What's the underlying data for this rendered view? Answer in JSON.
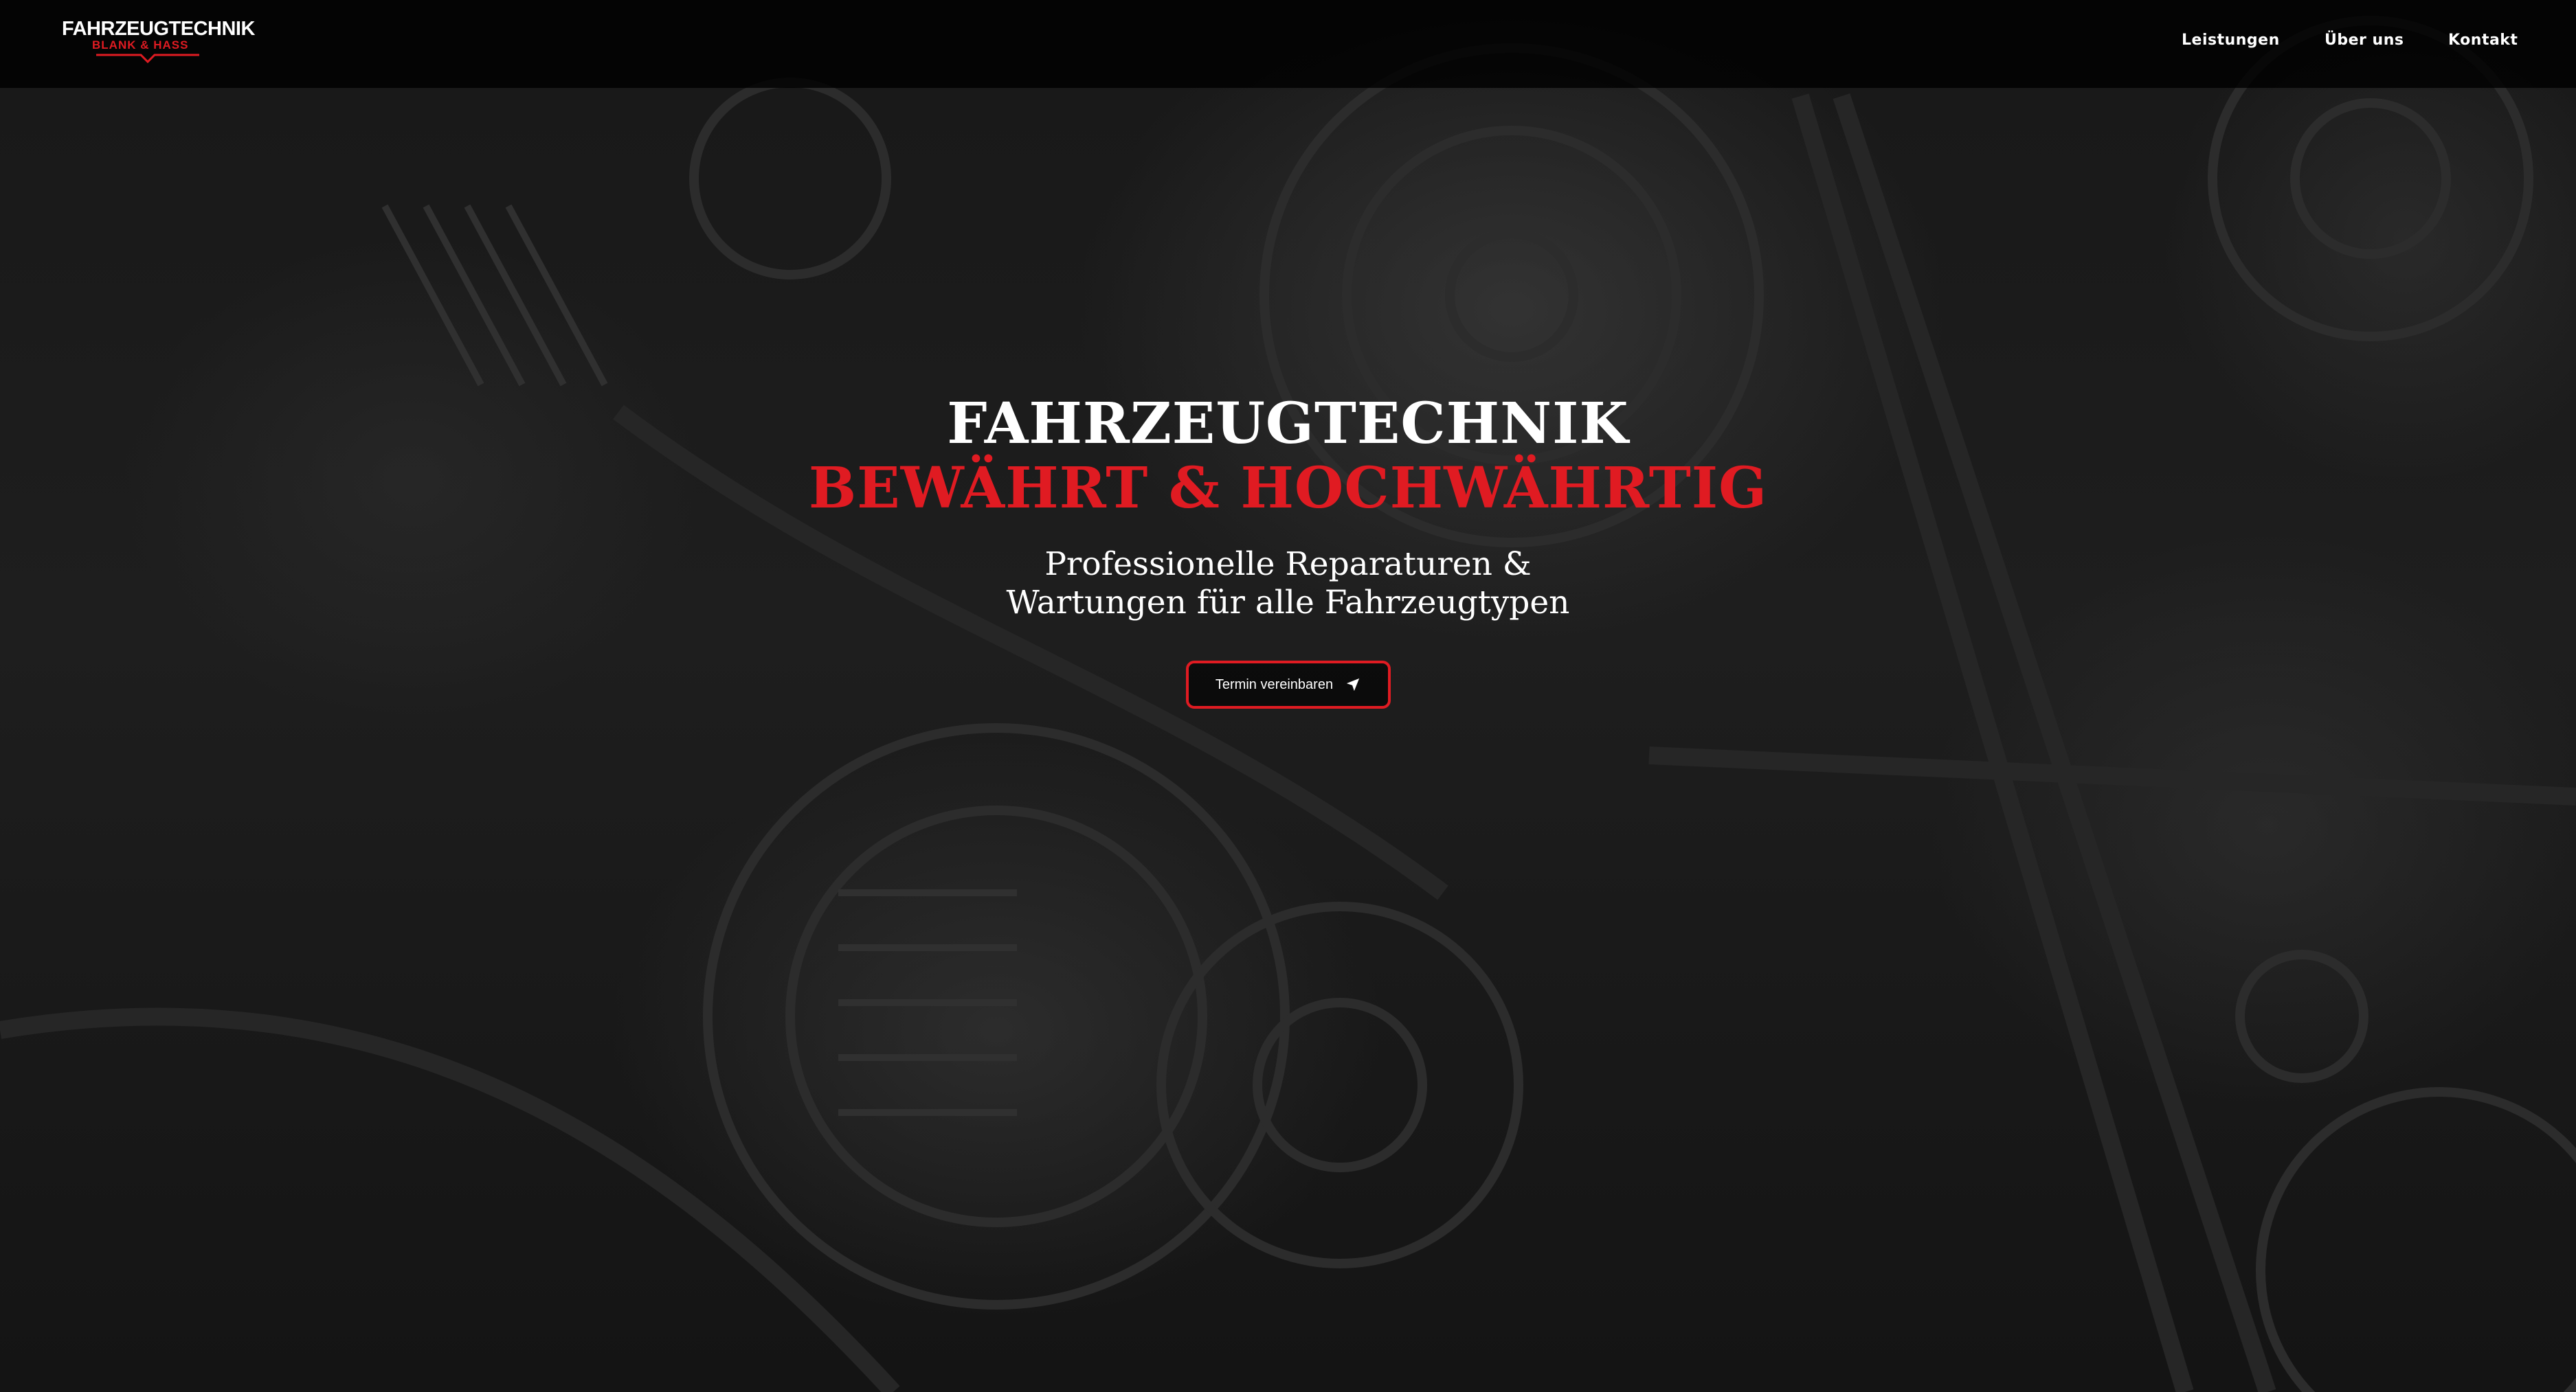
{
  "header": {
    "logo": {
      "title": "FAHRZEUGTECHNIK",
      "subtitle": "BLANK & HASS"
    },
    "nav": [
      {
        "label": "Leistungen"
      },
      {
        "label": "Über uns"
      },
      {
        "label": "Kontakt"
      }
    ]
  },
  "hero": {
    "title_line1": "FAHRZEUGTECHNIK",
    "title_line2": "BEWÄHRT & HOCHWÄHRTIG",
    "subtitle_line1": "Professionelle Reparaturen &",
    "subtitle_line2": "Wartungen für alle Fahrzeugtypen",
    "cta_label": "Termin vereinbaren",
    "cta_icon": "send-arrow-icon",
    "background": "engine-photo"
  },
  "colors": {
    "accent": "#e01b22",
    "navbar_bg": "#000000",
    "text": "#ffffff"
  }
}
